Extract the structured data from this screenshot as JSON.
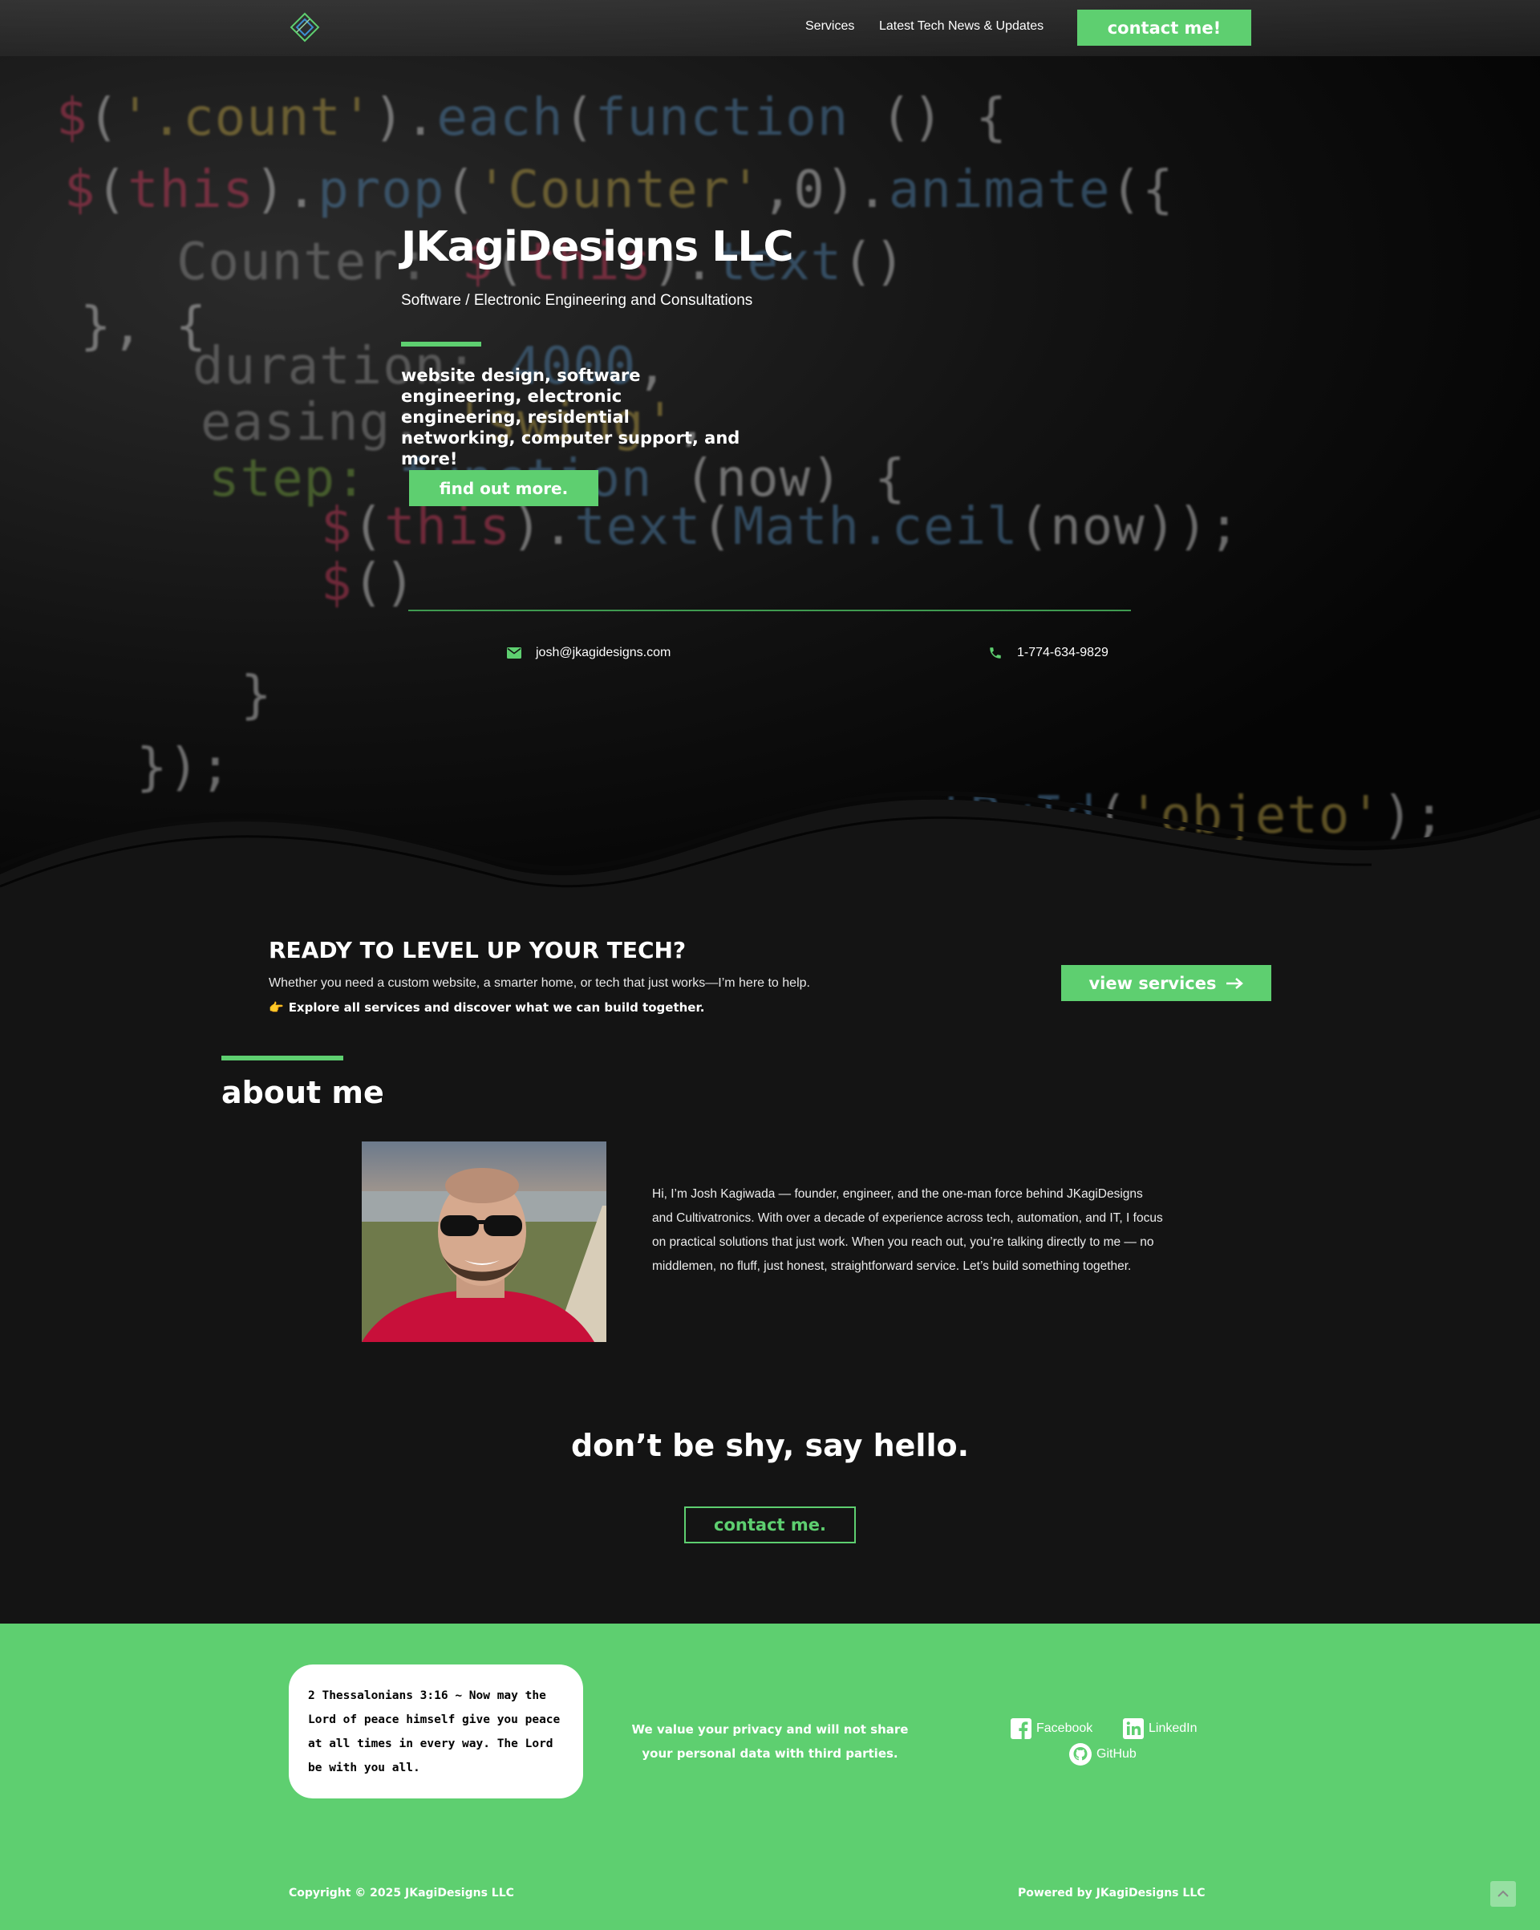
{
  "nav": {
    "logo_icon": "diamond-logo-icon",
    "links": [
      "Services",
      "Latest Tech News & Updates"
    ],
    "contact_label": "contact me!"
  },
  "hero": {
    "title": "JKagiDesigns LLC",
    "subtitle": "Software / Electronic Engineering and Consultations",
    "services": "website design, software engineering, electronic engineering, residential networking, computer support, and more!",
    "button_label": "find out more.",
    "email": "josh@jkagidesigns.com",
    "phone": "1-774-634-9829"
  },
  "cta": {
    "title": "READY TO LEVEL UP YOUR TECH?",
    "text": "Whether you need a custom website, a smarter home, or tech that just works—I’m here to help.",
    "emoji": "👉",
    "link_text": "Explore all services and discover what we can build together.",
    "button_label": "view services"
  },
  "about": {
    "title": "about me",
    "bio": "Hi, I’m Josh Kagiwada — founder, engineer, and the one-man force behind JKagiDesigns and Cultivatronics. With over a decade of experience across tech, automation, and IT, I focus on practical solutions that just work. When you reach out, you’re talking directly to me — no middlemen, no fluff, just honest, straightforward service. Let’s build something together."
  },
  "hello": {
    "title": "don’t be shy, say hello.",
    "button_label": "contact me."
  },
  "footer": {
    "verse": "2 Thessalonians 3:16 ~ Now may the Lord of peace himself give you peace at all times in every way. The Lord be with you all.",
    "privacy": "We value your privacy and will not share your personal data with third parties.",
    "social": [
      "Facebook",
      "LinkedIn",
      "GitHub"
    ],
    "copyright": "Copyright © 2025 JKagiDesigns LLC",
    "powered": "Powered by JKagiDesigns LLC"
  },
  "colors": {
    "accent": "#5ecf70",
    "background": "#141414",
    "text": "#ffffff"
  }
}
